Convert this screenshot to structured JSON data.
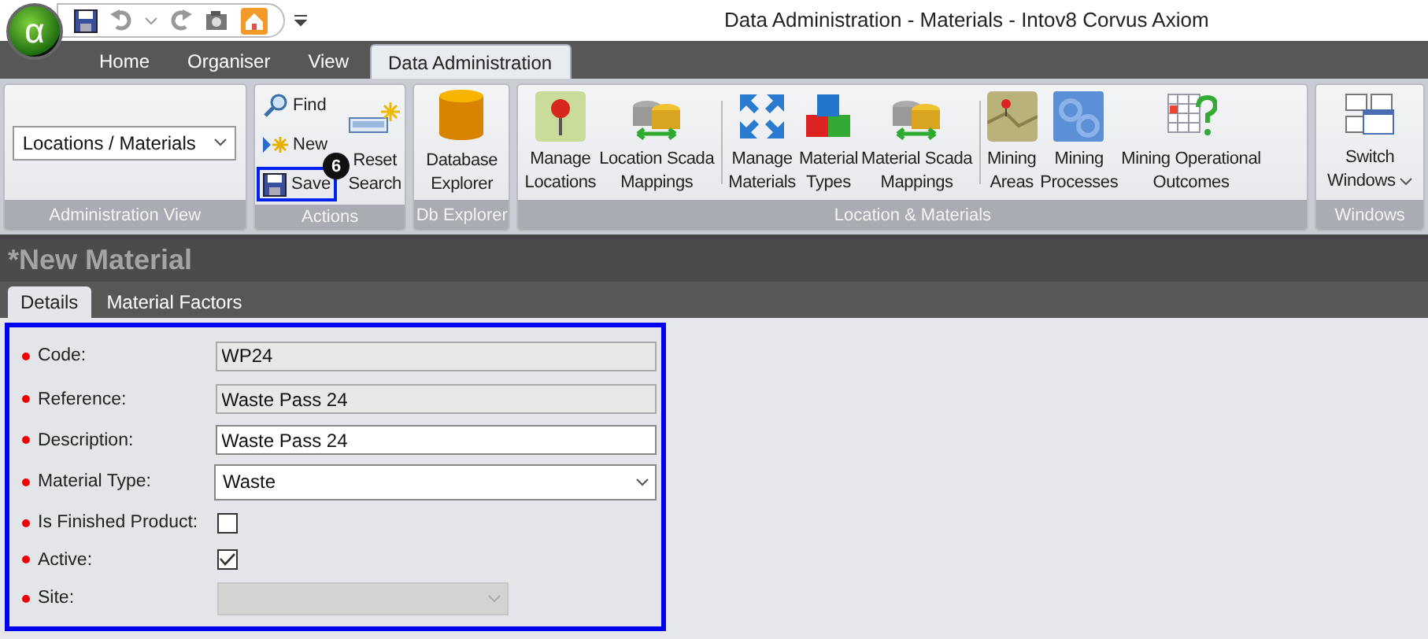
{
  "window": {
    "logo": "α",
    "title": "Data Administration - Materials - Intov8 Corvus Axiom"
  },
  "menu_tabs": [
    {
      "label": "Home",
      "selected": false
    },
    {
      "label": "Organiser",
      "selected": false
    },
    {
      "label": "View",
      "selected": false
    },
    {
      "label": "Data Administration",
      "selected": true
    }
  ],
  "ribbon": {
    "groups": [
      {
        "label": "Administration View",
        "kind": "combo",
        "value": "Locations / Materials"
      },
      {
        "label": "Actions",
        "kind": "actions",
        "small_items": [
          {
            "label": "Find",
            "highlighted": false
          },
          {
            "label": "New",
            "highlighted": false
          },
          {
            "label": "Save",
            "highlighted": true,
            "callout": "6"
          }
        ],
        "large_item": {
          "label": [
            "Reset",
            "Search"
          ]
        }
      },
      {
        "label": "Db Explorer",
        "kind": "large",
        "sections": [
          [
            {
              "label": [
                "Database",
                "Explorer"
              ],
              "dropdown": false
            }
          ]
        ]
      },
      {
        "label": "Location & Materials",
        "kind": "large",
        "sections": [
          [
            {
              "label": [
                "Manage",
                "Locations"
              ],
              "dropdown": false
            },
            {
              "label": [
                "Location Scada",
                "Mappings"
              ],
              "dropdown": false
            }
          ],
          [
            {
              "label": [
                "Manage",
                "Materials"
              ],
              "dropdown": false
            },
            {
              "label": [
                "Material",
                "Types"
              ],
              "dropdown": false
            },
            {
              "label": [
                "Material Scada",
                "Mappings"
              ],
              "dropdown": false
            }
          ],
          [
            {
              "label": [
                "Mining",
                "Areas"
              ],
              "dropdown": false
            },
            {
              "label": [
                "Mining",
                "Processes"
              ],
              "dropdown": false
            },
            {
              "label": [
                "Mining Operational",
                "Outcomes"
              ],
              "dropdown": false
            }
          ]
        ]
      },
      {
        "label": "Windows",
        "kind": "large",
        "sections": [
          [
            {
              "label": [
                "Switch",
                "Windows"
              ],
              "dropdown": true
            }
          ]
        ]
      }
    ]
  },
  "document": {
    "title": "*New Material",
    "tabs": [
      {
        "label": "Details",
        "selected": true
      },
      {
        "label": "Material Factors",
        "selected": false
      }
    ],
    "form": {
      "highlighted": true,
      "fields": [
        {
          "kind": "text",
          "label": "Code:",
          "required": true,
          "value": "WP24",
          "readonly": true
        },
        {
          "kind": "text",
          "label": "Reference:",
          "required": true,
          "value": "Waste Pass 24",
          "readonly": true
        },
        {
          "kind": "text",
          "label": "Description:",
          "required": true,
          "value": "Waste Pass 24",
          "readonly": false
        },
        {
          "kind": "select",
          "label": "Material Type:",
          "required": true,
          "value": "Waste",
          "disabled": false
        },
        {
          "kind": "checkbox",
          "label": "Is Finished Product:",
          "required": true,
          "checked": false
        },
        {
          "kind": "checkbox",
          "label": "Active:",
          "required": true,
          "checked": true
        },
        {
          "kind": "select",
          "label": "Site:",
          "required": true,
          "disabled": true
        }
      ]
    }
  }
}
